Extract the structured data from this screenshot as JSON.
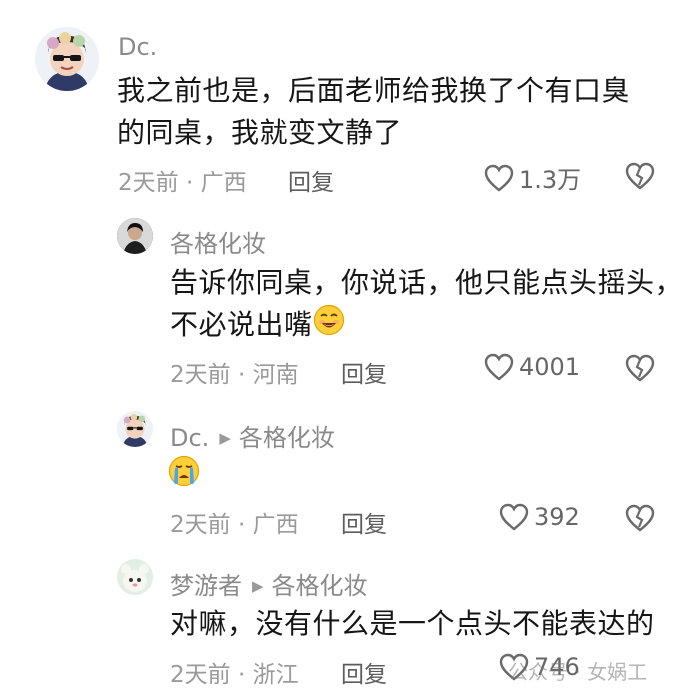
{
  "comments": [
    {
      "author": "Dc.",
      "text_line1": "我之前也是，后面老师给我换了个有口臭",
      "text_line2": "的同桌，我就变文静了",
      "meta": "2天前 · 广西",
      "reply_label": "回复",
      "likes": "1.3万"
    },
    {
      "author": "各格化妆",
      "text_line1": "告诉你同桌，你说话，他只能点头摇头，",
      "text_line2": "不必说出嘴",
      "meta": "2天前 · 河南",
      "reply_label": "回复",
      "likes": "4001"
    },
    {
      "author": "Dc.",
      "reply_to": "各格化妆",
      "meta": "2天前 · 广西",
      "reply_label": "回复",
      "likes": "392"
    },
    {
      "author": "梦游者",
      "reply_to": "各格化妆",
      "text_line1": "对嘛，没有什么是一个点头不能表达的",
      "meta": "2天前 · 浙江",
      "reply_label": "回复",
      "likes": "746"
    }
  ],
  "watermark": "公众号 · 女娲工",
  "colors": {
    "text": "#161616",
    "meta": "#9a9a9a",
    "icon": "#6a6a6a"
  },
  "icons": [
    "heart-outline-icon",
    "broken-heart-icon",
    "grinning-emoji",
    "crying-emoji"
  ]
}
